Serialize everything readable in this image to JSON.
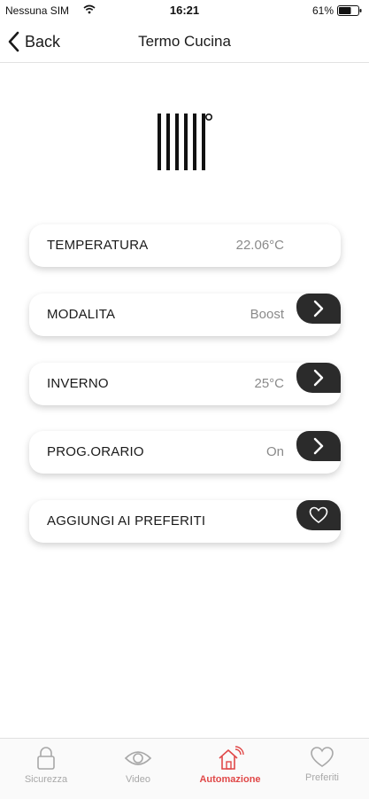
{
  "status_bar": {
    "carrier": "Nessuna SIM",
    "time": "16:21",
    "battery": "61%"
  },
  "nav": {
    "back_label": "Back",
    "title": "Termo Cucina"
  },
  "device_icon": "radiator-icon",
  "rows": [
    {
      "label": "TEMPERATURA",
      "value": "22.06°C"
    },
    {
      "label": "MODALITA",
      "value": "Boost",
      "action_icon": "chevron-right-icon"
    },
    {
      "label": "INVERNO",
      "value": "25°C",
      "action_icon": "chevron-right-icon"
    },
    {
      "label": "PROG.ORARIO",
      "value": "On",
      "action_icon": "chevron-right-icon"
    },
    {
      "label": "AGGIUNGI AI PREFERITI",
      "action_icon": "heart-icon"
    }
  ],
  "tabs": [
    {
      "label": "Sicurezza",
      "icon": "lock-icon"
    },
    {
      "label": "Video",
      "icon": "eye-icon"
    },
    {
      "label": "Automazione",
      "icon": "smart-home-icon",
      "active": true
    },
    {
      "label": "Preferiti",
      "icon": "heart-icon"
    }
  ],
  "colors": {
    "accent": "#e04848",
    "action_bg": "#2b2b2b",
    "inactive": "#a8a8a8"
  }
}
